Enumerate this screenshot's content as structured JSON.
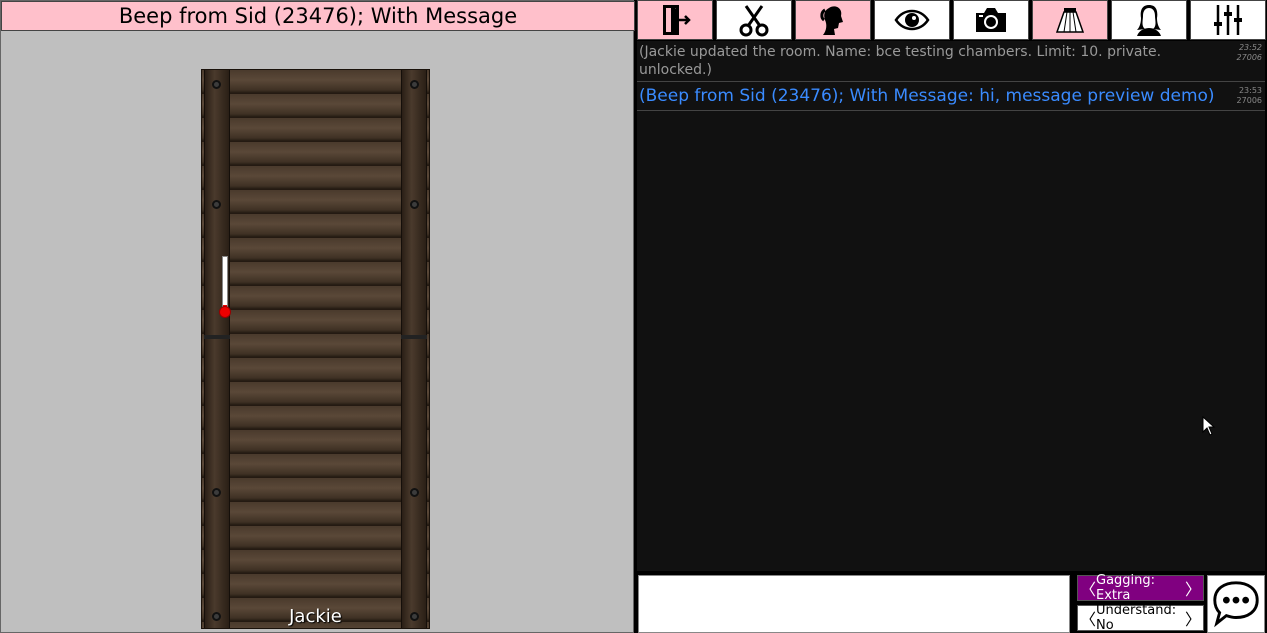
{
  "banner": {
    "text": "Beep from Sid (23476); With Message"
  },
  "scene": {
    "character_name": "Jackie",
    "arousal_level": 0.15
  },
  "toolbar": {
    "buttons": [
      {
        "icon": "exit-icon"
      },
      {
        "icon": "scissors-icon"
      },
      {
        "icon": "profile-icon"
      },
      {
        "icon": "eye-icon"
      },
      {
        "icon": "camera-icon"
      },
      {
        "icon": "skirt-icon"
      },
      {
        "icon": "character-icon"
      },
      {
        "icon": "sliders-icon"
      }
    ]
  },
  "chat": {
    "messages": [
      {
        "type": "system",
        "text": "(Jackie updated the room. Name: bce testing chambers. Limit: 10.  private.  unlocked.)",
        "time": "23:52",
        "id": "27006"
      },
      {
        "type": "beep",
        "text": "(Beep from Sid (23476); With Message: hi, message preview demo)",
        "time": "23:53",
        "id": "27006"
      }
    ]
  },
  "controls": {
    "input_value": "",
    "gagging_label": "Gagging: Extra",
    "understand_label": "Understand: No"
  },
  "colors": {
    "banner": "#ffc0cb",
    "beep_text": "#3a8bff",
    "gagging_bg": "#800080"
  }
}
